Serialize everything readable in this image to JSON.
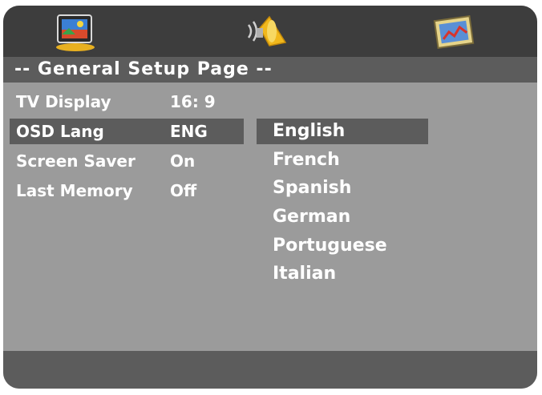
{
  "tabs": [
    {
      "icon": "tv-display-icon"
    },
    {
      "icon": "speaker-audio-icon"
    },
    {
      "icon": "picture-video-icon"
    }
  ],
  "page_title": "-- General Setup Page --",
  "menu": [
    {
      "label": "TV Display",
      "value": "16:  9",
      "selected": false
    },
    {
      "label": "OSD Lang",
      "value": "ENG",
      "selected": true
    },
    {
      "label": "Screen Saver",
      "value": "On",
      "selected": false
    },
    {
      "label": "Last Memory",
      "value": "Off",
      "selected": false
    }
  ],
  "submenu": [
    {
      "label": "English",
      "selected": true
    },
    {
      "label": "French",
      "selected": false
    },
    {
      "label": "Spanish",
      "selected": false
    },
    {
      "label": "German",
      "selected": false
    },
    {
      "label": "Portuguese",
      "selected": false
    },
    {
      "label": "Italian",
      "selected": false
    }
  ],
  "colors": {
    "tabbar": "#3d3d3d",
    "highlight": "#5c5c5c",
    "panel": "#9b9b9b",
    "text": "#ffffff"
  }
}
